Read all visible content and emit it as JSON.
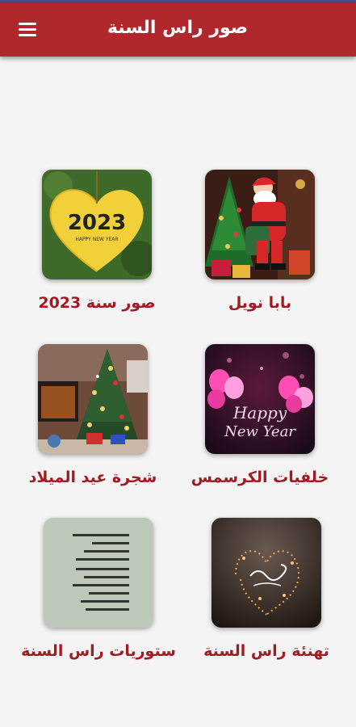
{
  "app": {
    "title": "صور راس السنة",
    "menu_icon": "hamburger-menu-icon",
    "accent": "#b0282c",
    "label_color": "#a01c22"
  },
  "items": [
    {
      "label": "بابا نويل",
      "image": "santa-claus-image"
    },
    {
      "label": "صور سنة 2023",
      "image": "golden-heart-leaf-image",
      "image_text": "2023",
      "image_subtext": "HAPPY NEW YEAR"
    },
    {
      "label": "خلفيات الكرسمس",
      "image": "happy-new-year-balloons-image",
      "image_text_1": "Happy",
      "image_text_2": "New Year"
    },
    {
      "label": "شجرة عيد الميلاد",
      "image": "christmas-tree-image"
    },
    {
      "label": "تهنئة راس السنة",
      "image": "calligraphy-lights-image"
    },
    {
      "label": "ستوريات راس السنة",
      "image": "stories-text-card-image"
    }
  ]
}
